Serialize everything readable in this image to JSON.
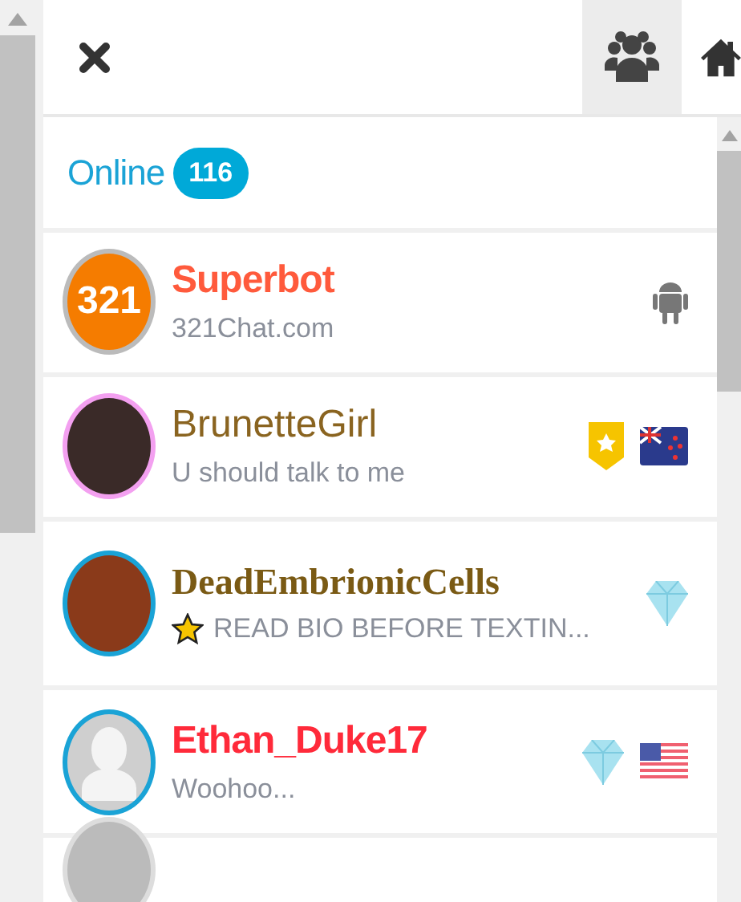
{
  "header": {
    "tabs": [
      {
        "kind": "people",
        "selected": true
      },
      {
        "kind": "home",
        "selected": false
      }
    ]
  },
  "online": {
    "label": "Online",
    "count": "116"
  },
  "users": [
    {
      "kind": "bot",
      "name": "Superbot",
      "color": "#ff5a3c",
      "avatar_text": "321",
      "status": "321Chat.com",
      "starred": false,
      "badges": [
        {
          "kind": "android"
        }
      ]
    },
    {
      "kind": "female",
      "name": "BrunetteGirl",
      "color": "#8a6420",
      "status": "U should talk to me",
      "starred": false,
      "badges": [
        {
          "kind": "shield"
        },
        {
          "kind": "nz"
        }
      ]
    },
    {
      "kind": "fancy",
      "name": "DeadEmbrionicCells",
      "color": "#7a5a14",
      "status": "READ BIO BEFORE TEXTIN...",
      "starred": true,
      "badges": [
        {
          "kind": "diamond"
        }
      ]
    },
    {
      "kind": "male",
      "name": "Ethan_Duke17",
      "color": "#ff2a3a",
      "status": "Woohoo...",
      "starred": false,
      "badges": [
        {
          "kind": "diamond"
        },
        {
          "kind": "us"
        }
      ]
    }
  ]
}
